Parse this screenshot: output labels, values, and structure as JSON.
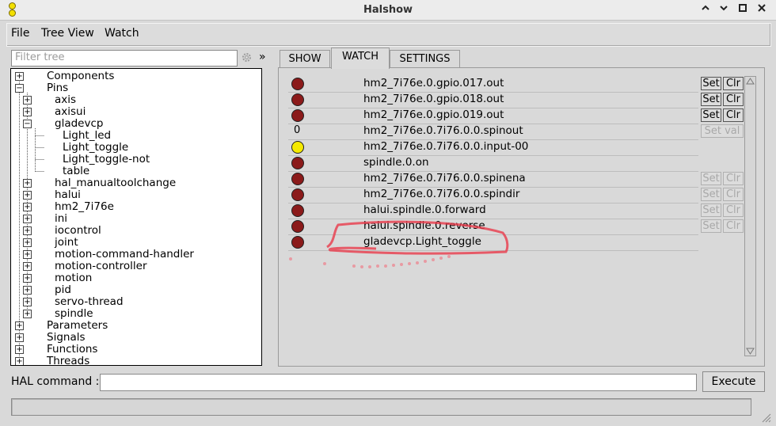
{
  "window": {
    "title": "Halshow"
  },
  "menu": [
    "File",
    "Tree View",
    "Watch"
  ],
  "filter": {
    "placeholder": "Filter tree",
    "collapse_label": "»"
  },
  "tree": [
    {
      "label": "Components",
      "level": 0,
      "expander": "+"
    },
    {
      "label": "Pins",
      "level": 0,
      "expander": "−"
    },
    {
      "label": "axis",
      "level": 1,
      "expander": "+"
    },
    {
      "label": "axisui",
      "level": 1,
      "expander": "+"
    },
    {
      "label": "gladevcp",
      "level": 1,
      "expander": "−"
    },
    {
      "label": "Light_led",
      "level": 2,
      "expander": ""
    },
    {
      "label": "Light_toggle",
      "level": 2,
      "expander": ""
    },
    {
      "label": "Light_toggle-not",
      "level": 2,
      "expander": ""
    },
    {
      "label": "table",
      "level": 2,
      "expander": ""
    },
    {
      "label": "hal_manualtoolchange",
      "level": 1,
      "expander": "+"
    },
    {
      "label": "halui",
      "level": 1,
      "expander": "+"
    },
    {
      "label": "hm2_7i76e",
      "level": 1,
      "expander": "+"
    },
    {
      "label": "ini",
      "level": 1,
      "expander": "+"
    },
    {
      "label": "iocontrol",
      "level": 1,
      "expander": "+"
    },
    {
      "label": "joint",
      "level": 1,
      "expander": "+"
    },
    {
      "label": "motion-command-handler",
      "level": 1,
      "expander": "+"
    },
    {
      "label": "motion-controller",
      "level": 1,
      "expander": "+"
    },
    {
      "label": "motion",
      "level": 1,
      "expander": "+"
    },
    {
      "label": "pid",
      "level": 1,
      "expander": "+"
    },
    {
      "label": "servo-thread",
      "level": 1,
      "expander": "+"
    },
    {
      "label": "spindle",
      "level": 1,
      "expander": "+"
    },
    {
      "label": "Parameters",
      "level": 0,
      "expander": "+"
    },
    {
      "label": "Signals",
      "level": 0,
      "expander": "+"
    },
    {
      "label": "Functions",
      "level": 0,
      "expander": "+"
    },
    {
      "label": "Threads",
      "level": 0,
      "expander": "+"
    }
  ],
  "tabs": [
    {
      "label": "SHOW",
      "active": false
    },
    {
      "label": "WATCH",
      "active": true
    },
    {
      "label": "SETTINGS",
      "active": false
    }
  ],
  "watch": [
    {
      "indicator": "red",
      "name": "hm2_7i76e.0.gpio.017.out",
      "buttons": "set-clr",
      "enabled": true
    },
    {
      "indicator": "red",
      "name": "hm2_7i76e.0.gpio.018.out",
      "buttons": "set-clr",
      "enabled": true
    },
    {
      "indicator": "red",
      "name": "hm2_7i76e.0.gpio.019.out",
      "buttons": "set-clr",
      "enabled": true
    },
    {
      "indicator": "value",
      "value": "0",
      "name": "hm2_7i76e.0.7i76.0.0.spinout",
      "buttons": "setval",
      "enabled": false
    },
    {
      "indicator": "yellow",
      "name": "hm2_7i76e.0.7i76.0.0.input-00",
      "buttons": "none",
      "enabled": false
    },
    {
      "indicator": "red",
      "name": "spindle.0.on",
      "buttons": "none",
      "enabled": false
    },
    {
      "indicator": "red",
      "name": "hm2_7i76e.0.7i76.0.0.spinena",
      "buttons": "set-clr",
      "enabled": false
    },
    {
      "indicator": "red",
      "name": "hm2_7i76e.0.7i76.0.0.spindir",
      "buttons": "set-clr",
      "enabled": false
    },
    {
      "indicator": "red",
      "name": "halui.spindle.0.forward",
      "buttons": "set-clr",
      "enabled": false
    },
    {
      "indicator": "red",
      "name": "halui.spindle.0.reverse",
      "buttons": "set-clr",
      "enabled": false
    },
    {
      "indicator": "red",
      "name": "gladevcp.Light_toggle",
      "buttons": "none",
      "enabled": false
    }
  ],
  "button_labels": {
    "set": "Set",
    "clr": "Clr",
    "setval": "Set val"
  },
  "command": {
    "label": "HAL command :",
    "value": "",
    "execute_label": "Execute"
  },
  "colors": {
    "led_red": "#8b1a1a",
    "led_yellow": "#f5ea00",
    "annotation": "#e83a4a"
  }
}
